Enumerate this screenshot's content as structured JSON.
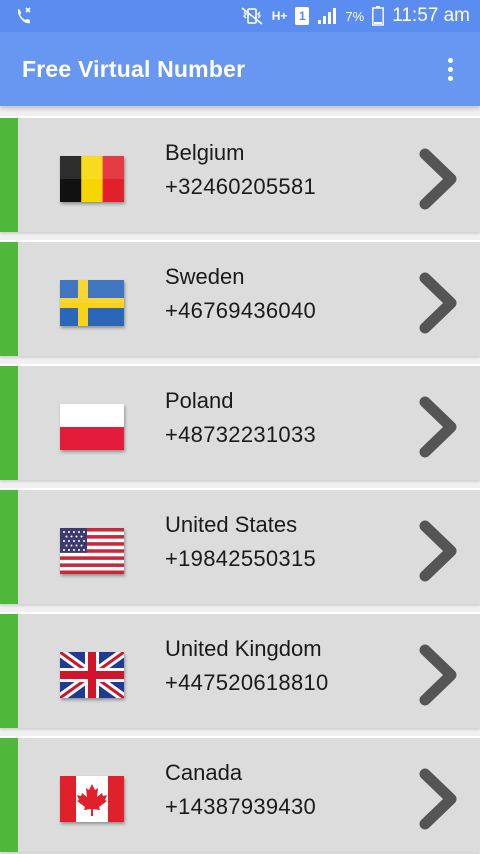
{
  "status_bar": {
    "battery": "7%",
    "time": "11:57 am",
    "network": "H+",
    "sim": "1"
  },
  "app_bar": {
    "title": "Free Virtual Number"
  },
  "numbers": [
    {
      "country": "Belgium",
      "number": "+32460205581",
      "flag": "belgium-flag-icon"
    },
    {
      "country": "Sweden",
      "number": "+46769436040",
      "flag": "sweden-flag-icon"
    },
    {
      "country": "Poland",
      "number": "+48732231033",
      "flag": "poland-flag-icon"
    },
    {
      "country": "United States",
      "number": "+19842550315",
      "flag": "us-flag-icon"
    },
    {
      "country": "United Kingdom",
      "number": "+447520618810",
      "flag": "uk-flag-icon"
    },
    {
      "country": "Canada",
      "number": "+14387939430",
      "flag": "canada-flag-icon"
    }
  ],
  "colors": {
    "status_bar": "#5b8df0",
    "app_bar": "#6897f2",
    "row_bg": "#dcdcdc",
    "accent": "#4fb83a",
    "chevron": "#555555"
  }
}
